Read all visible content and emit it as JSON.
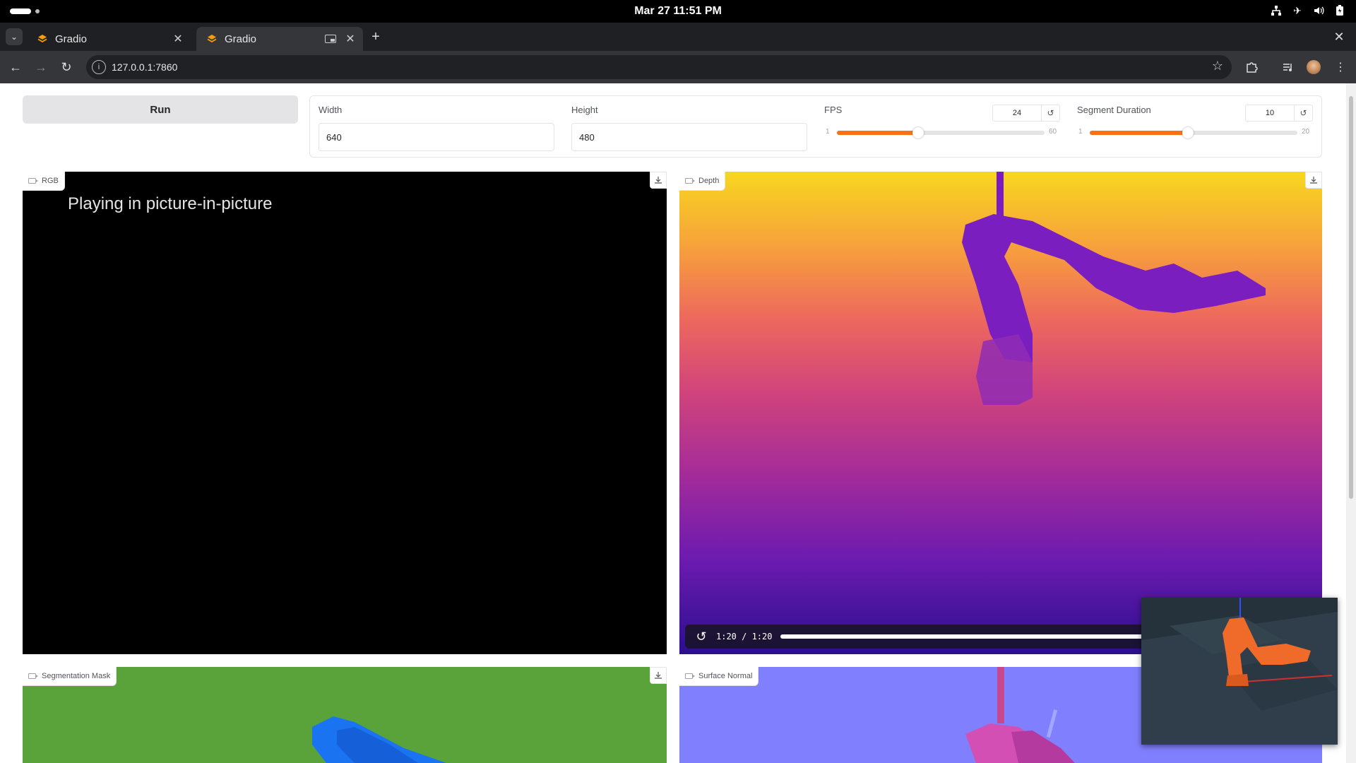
{
  "system": {
    "clock": "Mar 27  11:51 PM",
    "icons": [
      "network-icon",
      "airplane-mode-icon",
      "volume-icon",
      "battery-icon"
    ]
  },
  "browser": {
    "tabs": [
      {
        "title": "Gradio",
        "active": false
      },
      {
        "title": "Gradio",
        "active": true
      }
    ],
    "url": "127.0.0.1:7860"
  },
  "app": {
    "run_label": "Run",
    "width": {
      "label": "Width",
      "value": "640"
    },
    "height": {
      "label": "Height",
      "value": "480"
    },
    "fps": {
      "label": "FPS",
      "value": "24",
      "min": "1",
      "max": "60",
      "current": 24
    },
    "segment_duration": {
      "label": "Segment Duration",
      "value": "10",
      "min": "1",
      "max": "20",
      "current": 10
    },
    "panels": {
      "rgb": {
        "label": "RGB",
        "message": "Playing in picture-in-picture"
      },
      "depth": {
        "label": "Depth",
        "time": "1:20 / 1:20"
      },
      "segmentation": {
        "label": "Segmentation Mask"
      },
      "normal": {
        "label": "Surface Normal"
      }
    }
  },
  "colors": {
    "accent": "#f97316",
    "segmentation_bg": "#5aa23a",
    "segmentation_robot": "#1a73f0",
    "normal_bg": "#8080ff",
    "depth_top": "#f7d71f",
    "depth_bottom": "#2b0f8f"
  }
}
